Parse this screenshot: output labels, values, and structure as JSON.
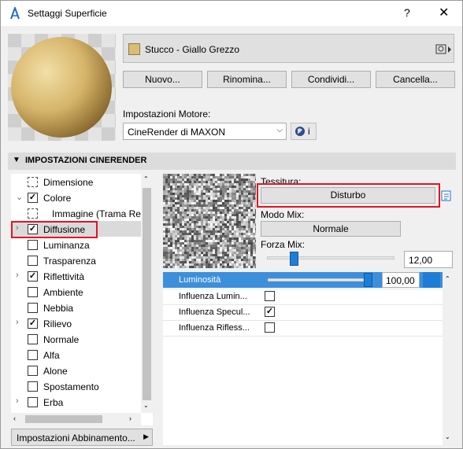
{
  "window": {
    "title": "Settaggi Superficie",
    "help": "?",
    "close": "✕"
  },
  "material": {
    "name": "Stucco - Giallo Grezzo",
    "swatch_color": "#d8bd74"
  },
  "actions": {
    "new_label": "Nuovo...",
    "rename_label": "Rinomina...",
    "share_label": "Condividi...",
    "delete_label": "Cancella..."
  },
  "engine": {
    "label": "Impostazioni Motore:",
    "value": "CineRender di MAXON",
    "info_glyph": "i"
  },
  "section": {
    "title": "IMPOSTAZIONI CINERENDER"
  },
  "channels": [
    {
      "label": "Dimensione",
      "expander": "",
      "checked": false,
      "icon": "dimension-icon"
    },
    {
      "label": "Colore",
      "expander": "⌄",
      "checked": true
    },
    {
      "label": "Immagine (Trama Resa",
      "expander": "",
      "checked": false,
      "icon": "image-icon"
    },
    {
      "label": "Diffusione",
      "expander": "›",
      "checked": true,
      "selected": true
    },
    {
      "label": "Luminanza",
      "expander": "",
      "checked": false
    },
    {
      "label": "Trasparenza",
      "expander": "",
      "checked": false
    },
    {
      "label": "Riflettività",
      "expander": "›",
      "checked": true
    },
    {
      "label": "Ambiente",
      "expander": "",
      "checked": false
    },
    {
      "label": "Nebbia",
      "expander": "",
      "checked": false
    },
    {
      "label": "Rilievo",
      "expander": "›",
      "checked": true
    },
    {
      "label": "Normale",
      "expander": "",
      "checked": false
    },
    {
      "label": "Alfa",
      "expander": "",
      "checked": false
    },
    {
      "label": "Alone",
      "expander": "",
      "checked": false
    },
    {
      "label": "Spostamento",
      "expander": "",
      "checked": false
    },
    {
      "label": "Erba",
      "expander": "›",
      "checked": false
    }
  ],
  "match_settings_label": "Impostazioni Abbinamento...",
  "texture": {
    "label": "Tessitura:",
    "value": "Disturbo"
  },
  "mix_mode": {
    "label": "Modo Mix:",
    "value": "Normale"
  },
  "mix_strength": {
    "label": "Forza Mix:",
    "value": "12,00",
    "level_percent": 12
  },
  "properties": [
    {
      "label": "Luminosità",
      "value": "100,00",
      "level_percent": 100,
      "selected": true
    },
    {
      "label": "Influenza Lumin...",
      "checked": false
    },
    {
      "label": "Influenza Specul...",
      "checked": true
    },
    {
      "label": "Influenza Rifless...",
      "checked": false
    }
  ],
  "colors": {
    "accent": "#1e7dd7",
    "selection": "#3d8fdc",
    "highlight": "#e81123"
  }
}
